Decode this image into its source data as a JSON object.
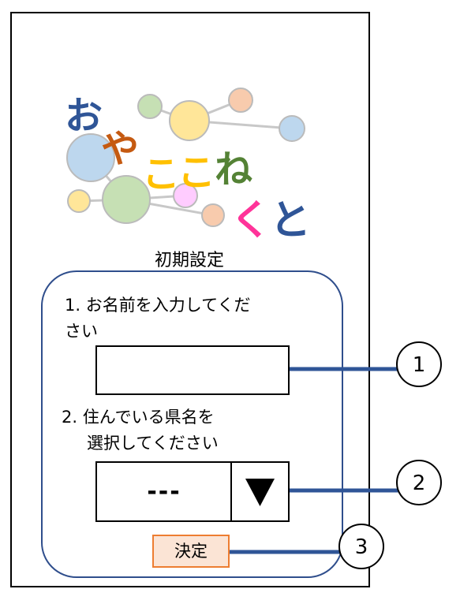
{
  "logo": {
    "text_line1": "おやここね",
    "text_line2": "くと",
    "char_o": "お",
    "char_ya": "や",
    "char_ko": "こ",
    "char_ne": "ね",
    "char_ku": "く",
    "char_to": "と"
  },
  "screen": {
    "title": "初期設定"
  },
  "form": {
    "name_label_line1": "1.  お名前を入力してくだ",
    "name_label_line2": "さい",
    "name_value": "",
    "pref_label_line1": "2. 住んでいる県名を",
    "pref_label_line2": "選択してください",
    "pref_selected": "---",
    "submit_label": "決定"
  },
  "callouts": {
    "c1": "1",
    "c2": "2",
    "c3": "3"
  },
  "colors": {
    "panel_border": "#2f4e8c",
    "callout_line": "#2f5597",
    "submit_fill": "#fbe4d5",
    "submit_border": "#ed7d31"
  }
}
